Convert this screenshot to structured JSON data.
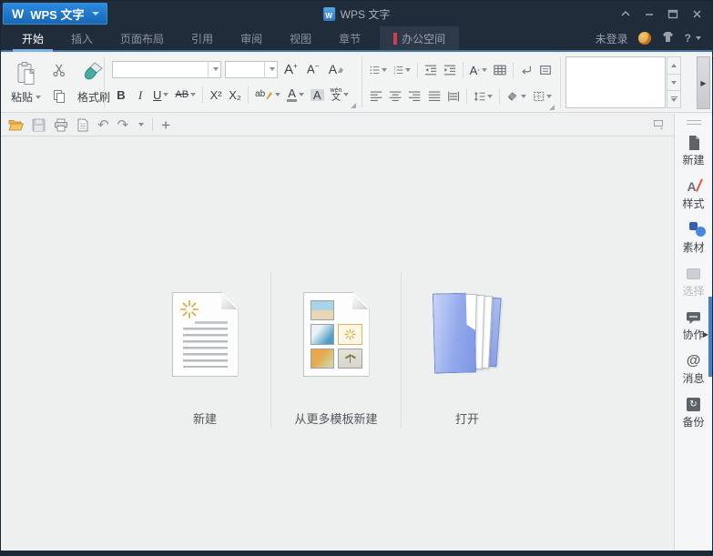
{
  "colors": {
    "titlebar_bg": "#212c3b",
    "app_button_blue": "#1f7bd0",
    "ribbon_line_blue": "#47749e",
    "active_tab_underline": "#7db4e8",
    "office_space_flag_red": "#c94050",
    "ribbon_bg": "#f2f3f3",
    "content_bg": "#eeefef",
    "sidebar_bg": "#f5f6f7",
    "open_folder_orange": "#e9a33b",
    "material_blue": "#4a86e0",
    "edge_panel_blue": "#4a7cc8"
  },
  "titlebar": {
    "app_button": {
      "logo": "W",
      "label": "WPS 文字"
    },
    "title": "WPS 文字",
    "doc_icon_letter": "W"
  },
  "tabs": {
    "items": [
      "开始",
      "插入",
      "页面布局",
      "引用",
      "审阅",
      "视图",
      "章节",
      "办公空间"
    ],
    "active": "开始"
  },
  "account": {
    "login": "未登录",
    "help": "?"
  },
  "ribbon": {
    "clipboard": {
      "paste": "粘贴",
      "format_painter": "格式刷"
    },
    "font": {
      "name_value": "",
      "size_value": "",
      "grow": "A",
      "grow_sign": "+",
      "shrink": "A",
      "shrink_sign": "−",
      "clear": "A",
      "bold": "B",
      "italic": "I",
      "underline": "U",
      "strikethrough": "AB",
      "superscript": "X²",
      "subscript": "X₂",
      "highlight": "ab",
      "color": "A",
      "shading": "A",
      "pinyin_top": "wén",
      "pinyin_bottom": "文"
    },
    "text_tool_letter": "A"
  },
  "quickbar": {
    "undo": "↶",
    "redo": "↷",
    "plus": "+"
  },
  "actions": [
    {
      "label": "新建"
    },
    {
      "label": "从更多模板新建"
    },
    {
      "label": "打开"
    }
  ],
  "sidebar": {
    "items": [
      {
        "label": "新建",
        "disabled": false
      },
      {
        "label": "样式",
        "disabled": false
      },
      {
        "label": "素材",
        "disabled": false
      },
      {
        "label": "选择",
        "disabled": true
      },
      {
        "label": "协作",
        "disabled": false
      },
      {
        "label": "消息",
        "disabled": false
      },
      {
        "label": "备份",
        "disabled": false
      }
    ]
  },
  "icons": {
    "message_glyph": "@",
    "backup_glyph": "↻",
    "panel_arrow": "▶",
    "expand_arrow": "▶"
  }
}
